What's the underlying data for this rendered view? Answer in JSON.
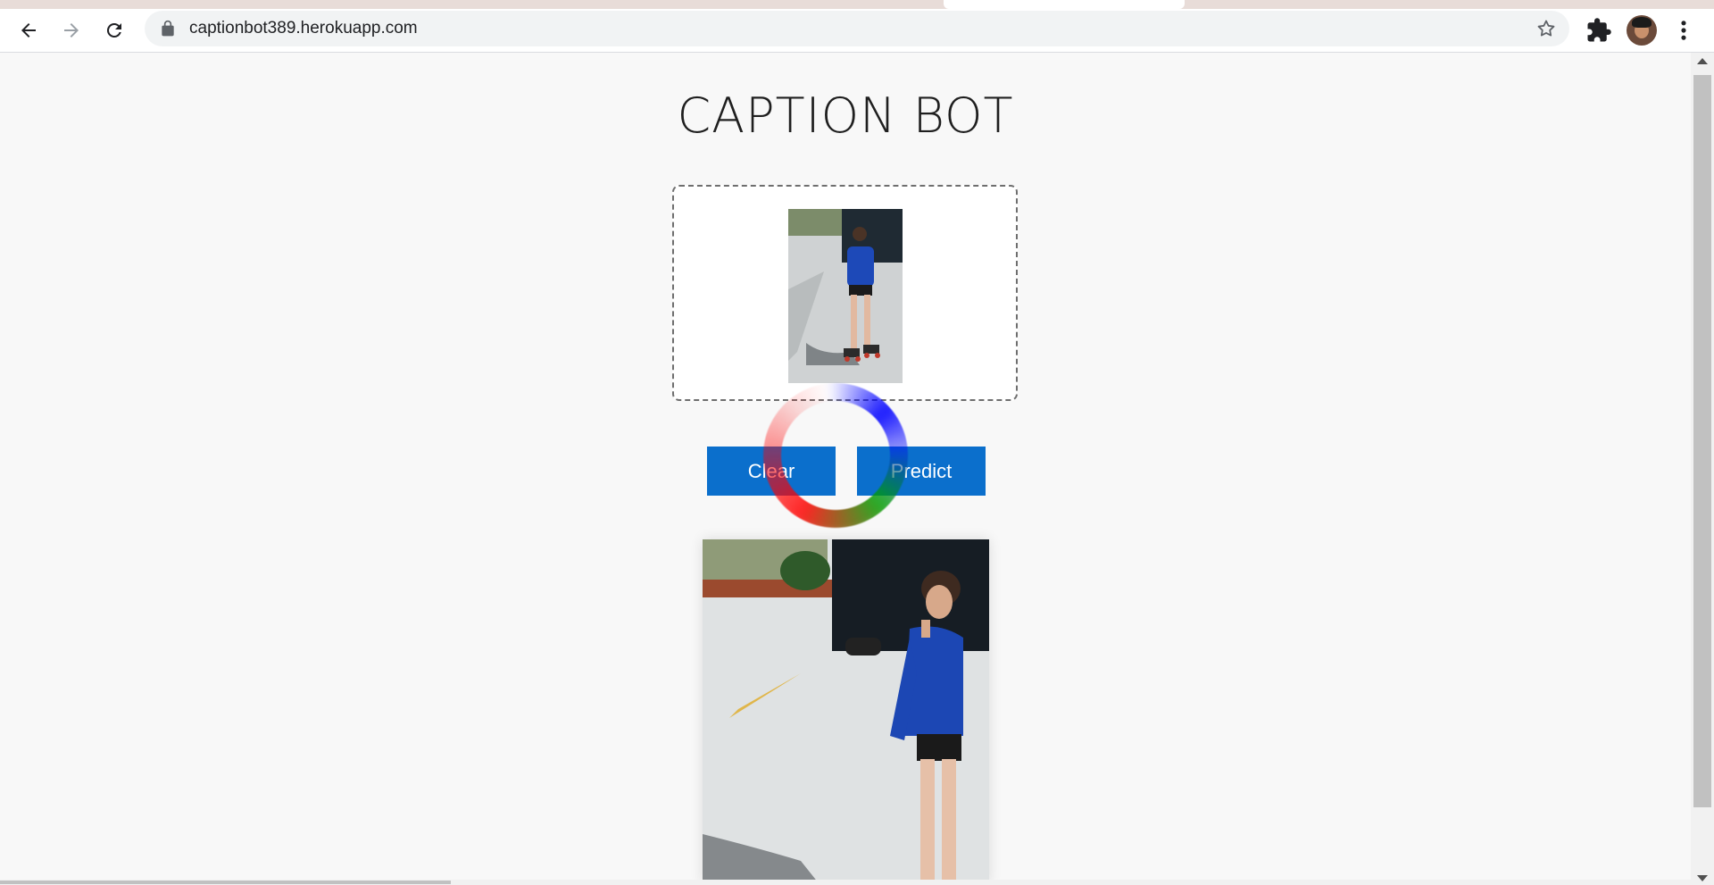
{
  "browser": {
    "url": "captionbot389.herokuapp.com",
    "icons": [
      "back-icon",
      "forward-icon",
      "reload-icon",
      "lock-icon",
      "star-icon",
      "extensions-icon",
      "avatar",
      "menu-icon"
    ]
  },
  "page": {
    "title": "CAPTION BOT",
    "buttons": {
      "clear_label": "Clear",
      "predict_label": "Predict"
    }
  },
  "colors": {
    "button_bg": "#0b6fcc",
    "page_bg": "#f8f8f8",
    "drop_zone_border": "#6e6e6e"
  }
}
